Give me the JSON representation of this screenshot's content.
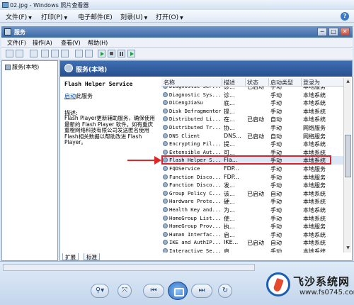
{
  "photo_viewer": {
    "title": "02.jpg - Windows 照片查看器",
    "menus": [
      {
        "label": "文件(F)"
      },
      {
        "label": "打印(P)"
      },
      {
        "label": "电子邮件(E)"
      },
      {
        "label": "刻录(U)"
      },
      {
        "label": "打开(O)"
      }
    ],
    "help_icon": "?"
  },
  "services_window": {
    "title": "服务",
    "window_buttons": [
      "─",
      "□",
      "✕"
    ],
    "menus": [
      {
        "label": "文件(F)"
      },
      {
        "label": "操作(A)"
      },
      {
        "label": "查看(V)"
      },
      {
        "label": "帮助(H)"
      }
    ],
    "tree_item": "服务(本地)",
    "pane_title": "服务(本地)",
    "selected_service": {
      "title": "Flash Helper Service",
      "start_link": "启动",
      "start_suffix": "此服务",
      "desc_label": "描述:",
      "description": "Flash Player更新辅助服务，确保使用最新的 Flash Player 软件。如有重庆重橙网络科技有限公司发送匿名使用Flash相关数据以帮助改进 Flash Player。"
    },
    "columns": [
      "名称",
      "描述",
      "状态",
      "启动类型",
      "登录为"
    ],
    "rows": [
      [
        "Diagnostic Ser...",
        "诊...",
        "已启动",
        "手动",
        "本地服务"
      ],
      [
        "Diagnostic Sys...",
        "诊...",
        "",
        "手动",
        "本地系统"
      ],
      [
        "DiCengJiaSu",
        "底...",
        "",
        "手动",
        "本地系统"
      ],
      [
        "Disk Defragmenter",
        "提...",
        "",
        "手动",
        "本地系统"
      ],
      [
        "Distributed Li...",
        "在...",
        "已启动",
        "自动",
        "本地系统"
      ],
      [
        "Distributed Tr...",
        "协...",
        "",
        "手动",
        "网络服务"
      ],
      [
        "DNS Client",
        "DNS...",
        "已启动",
        "自动",
        "网络服务"
      ],
      [
        "Encrypting Fil...",
        "提...",
        "",
        "手动",
        "本地系统"
      ],
      [
        "Extensible Aut...",
        "可...",
        "",
        "手动",
        "本地系统"
      ],
      [
        "Flash Helper S...",
        "Fla...",
        "",
        "手动",
        "本地系统"
      ],
      [
        "FQDService",
        "FDP...",
        "",
        "手动",
        "本地服务"
      ],
      [
        "Function Disco...",
        "FDP...",
        "",
        "手动",
        "本地服务"
      ],
      [
        "Function Disco...",
        "发...",
        "",
        "手动",
        "本地服务"
      ],
      [
        "Group Policy C...",
        "该...",
        "已启动",
        "自动",
        "本地系统"
      ],
      [
        "Hardware Prote...",
        "硬...",
        "",
        "手动",
        "本地系统"
      ],
      [
        "Health Key and...",
        "为...",
        "",
        "手动",
        "本地系统"
      ],
      [
        "HomeGroup List...",
        "使...",
        "",
        "手动",
        "本地系统"
      ],
      [
        "HomeGroup Prov...",
        "执...",
        "",
        "手动",
        "本地服务"
      ],
      [
        "Human Interfac...",
        "启...",
        "",
        "手动",
        "本地系统"
      ],
      [
        "IKE and AuthIP...",
        "IKE...",
        "已启动",
        "自动",
        "本地系统"
      ],
      [
        "Interactive Se...",
        "启...",
        "",
        "手动",
        "本地系统"
      ]
    ],
    "tabs": [
      {
        "label": "扩展"
      },
      {
        "label": "标准"
      }
    ]
  },
  "controls": {
    "zoom": "⚲▾",
    "fit": "⤧",
    "prev": "⏮",
    "next": "⏭",
    "rotate": "↻"
  },
  "watermark": {
    "name": "飞沙系统网",
    "url": "www.fs0745.com"
  },
  "colors": {
    "highlight": "#d6232a",
    "arrow": "#e02525",
    "title_bar": "#3d6aa5"
  }
}
